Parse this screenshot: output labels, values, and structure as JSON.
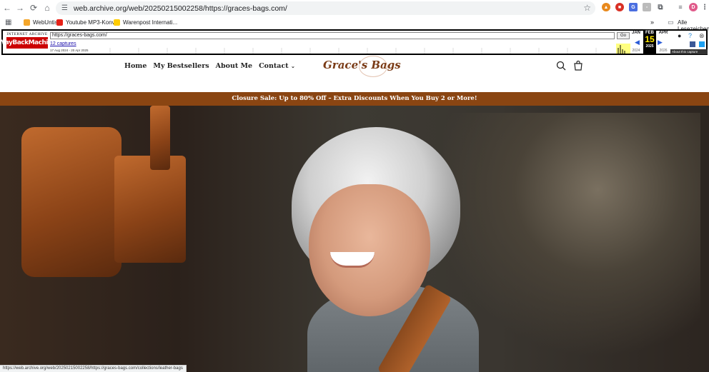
{
  "browser": {
    "address_url": "web.archive.org/web/20250215002258/https://graces-bags.com/",
    "bookmarks": [
      {
        "label": "WebUntis",
        "icon": "webuntis-icon"
      },
      {
        "label": "Youtube MP3-Konv...",
        "icon": "youtube-icon"
      },
      {
        "label": "Warenpost Internati...",
        "icon": "dhl-icon"
      }
    ],
    "bookmarks_more": "»",
    "all_bookmarks_label": "Alle Lesezeichen",
    "profile_initial": "D",
    "status_url": "https://web.archive.org/web/20250215002258/https://graces-bags.com/collections/leather-bags"
  },
  "wayback": {
    "logo_top": "INTERNET ARCHIVE",
    "logo_text": "WayBackMachine",
    "url_value": "https://graces-bags.com/",
    "go_label": "Go",
    "captures_label": "12 captures",
    "range_label": "17 Aug 2024 - 20 Apr 2025",
    "prev_month": "JAN",
    "cur_month": "FEB",
    "next_month": "APR",
    "cur_day": "15",
    "prev_year": "2024",
    "cur_year": "2025",
    "next_year": "2026",
    "about_label": "About this capture"
  },
  "site": {
    "nav": [
      "Home",
      "My Bestsellers",
      "About Me",
      "Contact"
    ],
    "logo": "Grace's Bags",
    "promo": "Closure Sale: Up to 80% Off – Extra Discounts When You Buy 2 or More!"
  },
  "colors": {
    "promo_bg": "#8a4512",
    "logo": "#7a3b16"
  }
}
